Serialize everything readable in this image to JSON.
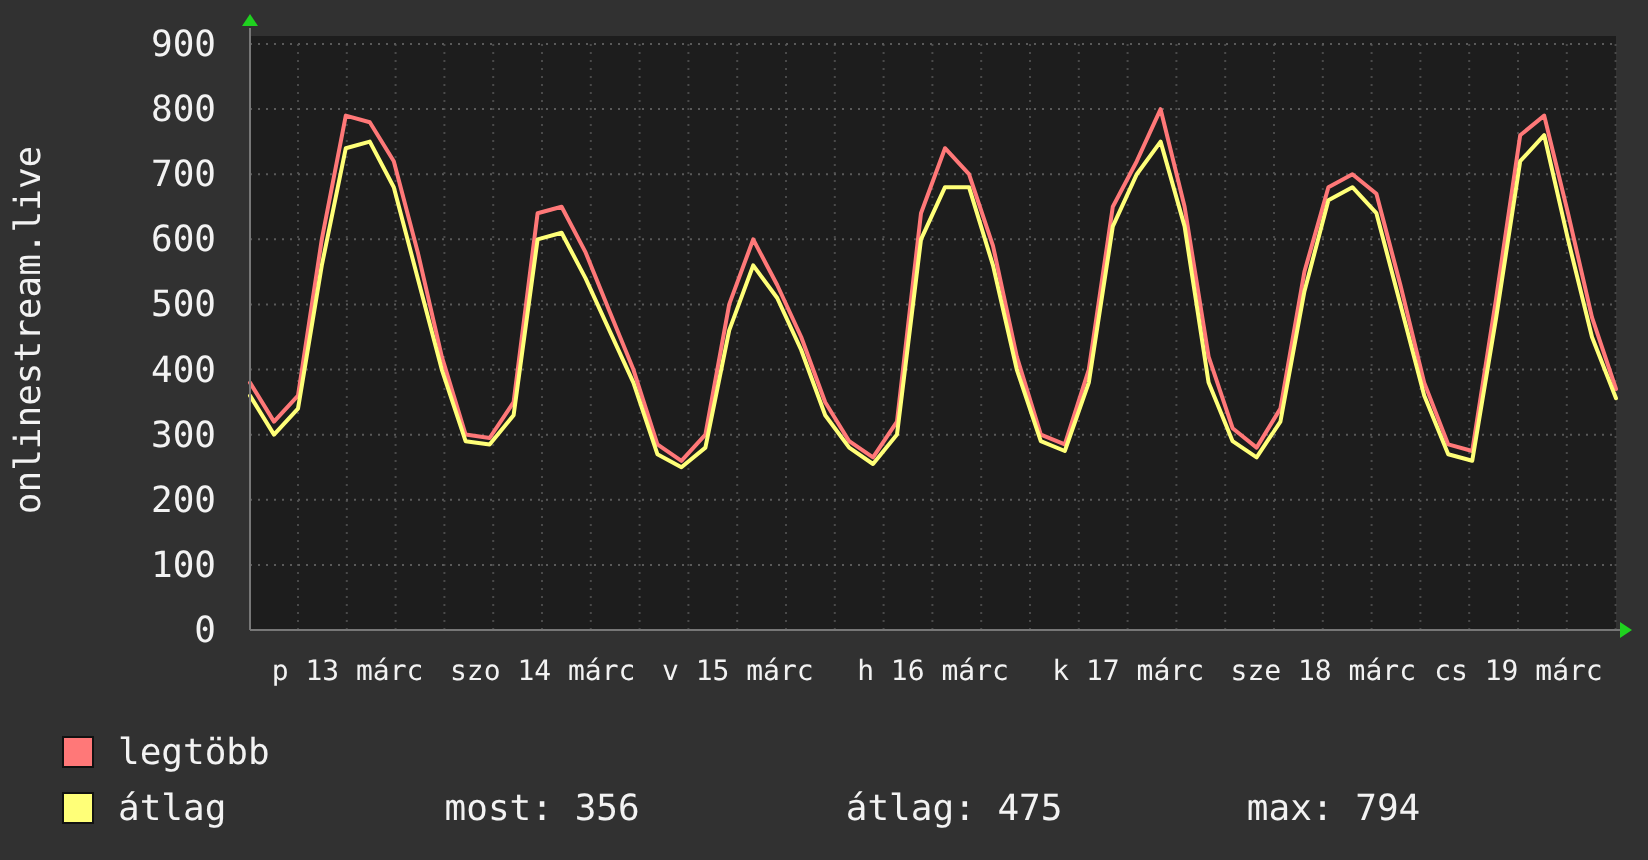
{
  "chart": {
    "x_labels": [
      "p 13 márc",
      "szo 14 márc",
      "v 15 márc",
      "h 16 márc",
      "k 17 márc",
      "sze 18 márc",
      "cs 19 márc"
    ],
    "chart_data": {
      "type": "line",
      "ylabel": "onlinestream.live",
      "grid": true,
      "ylim": [
        0,
        900
      ],
      "yticks": [
        0,
        100,
        200,
        300,
        400,
        500,
        600,
        700,
        800,
        900
      ],
      "series": [
        {
          "name": "legtöbb",
          "color": "#ff7878",
          "values": [
            380,
            320,
            360,
            600,
            790,
            780,
            720,
            580,
            420,
            300,
            295,
            350,
            640,
            650,
            580,
            490,
            400,
            285,
            260,
            300,
            500,
            600,
            530,
            450,
            350,
            290,
            265,
            320,
            640,
            740,
            700,
            590,
            420,
            300,
            285,
            400,
            650,
            720,
            800,
            650,
            420,
            310,
            280,
            340,
            550,
            680,
            700,
            670,
            530,
            380,
            285,
            275,
            510,
            760,
            790,
            640,
            480,
            370
          ]
        },
        {
          "name": "átlag",
          "color": "#ffff78",
          "values": [
            360,
            300,
            340,
            560,
            740,
            750,
            680,
            540,
            400,
            290,
            285,
            330,
            600,
            610,
            540,
            460,
            380,
            270,
            250,
            280,
            460,
            560,
            510,
            430,
            330,
            280,
            255,
            300,
            600,
            680,
            680,
            560,
            400,
            290,
            275,
            380,
            620,
            700,
            750,
            620,
            380,
            290,
            265,
            320,
            520,
            660,
            680,
            640,
            500,
            360,
            270,
            260,
            480,
            720,
            760,
            600,
            450,
            356
          ]
        }
      ]
    }
  },
  "legend_stats": [
    "most: 356",
    "átlag: 475",
    "max: 794"
  ]
}
